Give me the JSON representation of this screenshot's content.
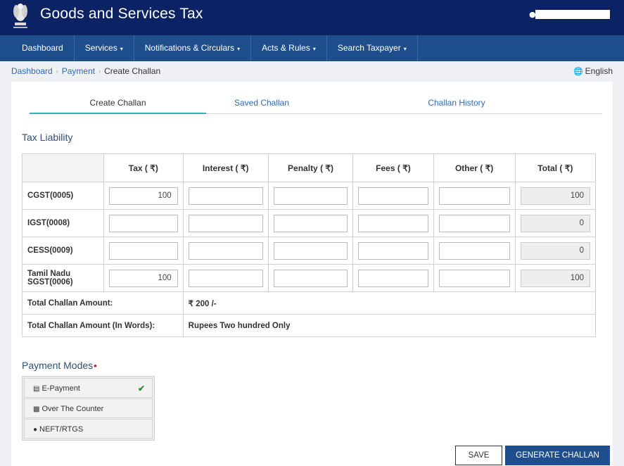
{
  "header": {
    "title": "Goods and Services Tax",
    "logo_icon": "national-emblem-icon",
    "user_icon": "user-icon"
  },
  "nav": {
    "items": [
      {
        "label": "Dashboard",
        "dropdown": false
      },
      {
        "label": "Services",
        "dropdown": true
      },
      {
        "label": "Notifications & Circulars",
        "dropdown": true
      },
      {
        "label": "Acts & Rules",
        "dropdown": true
      },
      {
        "label": "Search Taxpayer",
        "dropdown": true
      }
    ],
    "caret": "▾"
  },
  "breadcrumb": {
    "items": [
      "Dashboard",
      "Payment"
    ],
    "current": "Create Challan",
    "separator": "›"
  },
  "language": {
    "label": "English",
    "icon": "globe-icon"
  },
  "tabs": [
    {
      "label": "Create Challan",
      "active": true
    },
    {
      "label": "Saved Challan",
      "active": false
    },
    {
      "label": "Challan History",
      "active": false
    }
  ],
  "tax_liability": {
    "title": "Tax Liability",
    "columns": [
      "Tax ( ₹)",
      "Interest ( ₹)",
      "Penalty ( ₹)",
      "Fees ( ₹)",
      "Other ( ₹)",
      "Total ( ₹)"
    ],
    "rows": [
      {
        "label": "CGST(0005)",
        "tax": "100",
        "interest": "",
        "penalty": "",
        "fees": "",
        "other": "",
        "total": "100"
      },
      {
        "label": "IGST(0008)",
        "tax": "",
        "interest": "",
        "penalty": "",
        "fees": "",
        "other": "",
        "total": "0"
      },
      {
        "label": "CESS(0009)",
        "tax": "",
        "interest": "",
        "penalty": "",
        "fees": "",
        "other": "",
        "total": "0"
      },
      {
        "label": "Tamil Nadu SGST(0006)",
        "tax": "100",
        "interest": "",
        "penalty": "",
        "fees": "",
        "other": "",
        "total": "100"
      }
    ],
    "total_amount_label": "Total Challan Amount:",
    "total_amount_value": "200 /-",
    "currency_symbol": "₹",
    "total_words_label": "Total Challan Amount (In Words):",
    "total_words_value": "Rupees Two hundred Only"
  },
  "payment_modes": {
    "title": "Payment Modes",
    "required_mark": "•",
    "items": [
      {
        "label": "E-Payment",
        "icon": "credit-card-icon",
        "selected": true
      },
      {
        "label": "Over The Counter",
        "icon": "cash-icon",
        "selected": false
      },
      {
        "label": "NEFT/RTGS",
        "icon": "globe-icon",
        "selected": false
      }
    ],
    "check_mark": "✔"
  },
  "buttons": {
    "save": "SAVE",
    "generate": "GENERATE CHALLAN"
  },
  "colors": {
    "header_bg": "#0b2265",
    "nav_bg": "#1f4e8c",
    "tab_active_underline": "#2ab5b1",
    "link": "#2f6bb3",
    "required": "#d0021b",
    "check": "#2e8b3a"
  }
}
